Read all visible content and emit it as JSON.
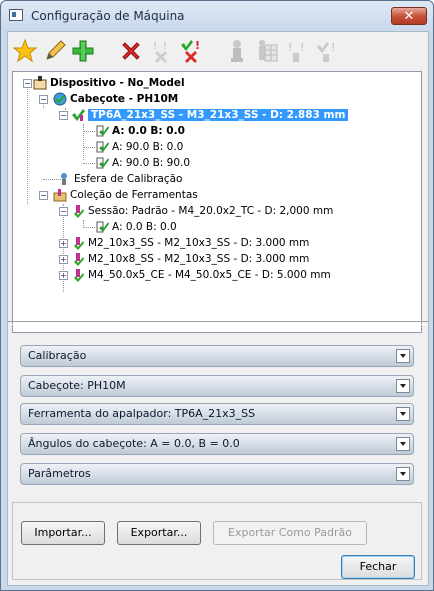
{
  "window": {
    "title": "Configuração de Máquina",
    "close_label": "✕"
  },
  "toolbar": {
    "icons": [
      "star-icon",
      "pencil-icon",
      "plus-icon",
      "delete-icon",
      "delete-warning-icon",
      "check-delete-icon",
      "probe-icon",
      "grid-icon",
      "warning-icon",
      "check-warning-icon"
    ]
  },
  "tree": {
    "device": "Dispositivo - No_Model",
    "head": "Cabeçote - PH10M",
    "probe": "TP6A_21x3_SS - M3_21x3_SS - D: 2.883 mm",
    "angle1": "A: 0.0 B: 0.0",
    "angle2": "A: 90.0 B: 0.0",
    "angle3": "A: 90.0 B: 90.0",
    "sphere": "Esfera de Calibração",
    "tools": "Coleção de Ferramentas",
    "session": "Sessão: Padrão - M4_20.0x2_TC - D: 2,000 mm",
    "session_angle": "A: 0.0 B: 0.0",
    "tool1": "M2_10x3_SS - M2_10x3_SS - D: 3.000 mm",
    "tool2": "M2_10x8_SS - M2_10x3_SS - D: 3.000 mm",
    "tool3": "M4_50.0x5_CE - M4_50.0x5_CE - D: 5.000 mm"
  },
  "panels": {
    "calibration": "Calibração",
    "head": "Cabeçote: PH10M",
    "probe_tool": "Ferramenta do apalpador: TP6A_21x3_SS",
    "angles": "Ângulos do cabeçote: A = 0.0, B = 0.0",
    "params": "Parâmetros"
  },
  "buttons": {
    "import": "Importar...",
    "export": "Exportar...",
    "export_default": "Exportar Como Padrão",
    "close": "Fechar"
  },
  "colors": {
    "selection": "#3399ff",
    "accent_green": "#2da52d",
    "accent_red": "#d42020"
  }
}
